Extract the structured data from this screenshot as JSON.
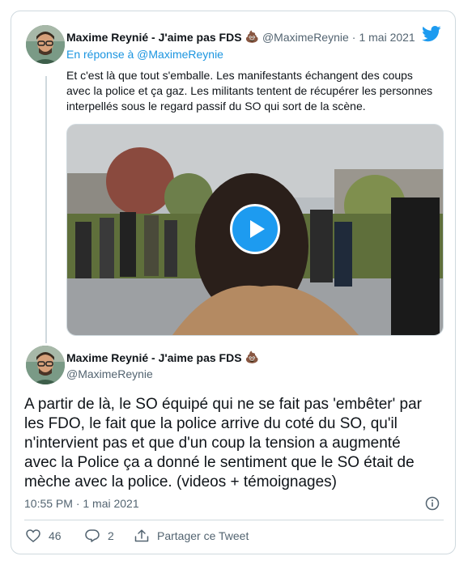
{
  "reply": {
    "author_name": "Maxime Reynié - J'aime pas FDS",
    "author_emoji": "💩",
    "author_handle": "@MaximeReynie",
    "dot": "·",
    "date": "1 mai 2021",
    "in_reply_to": "En réponse à @MaximeReynie",
    "text": "Et c'est là que tout s'emballe. Les manifestants échangent des coups avec la police et ça gaz. Les militants tentent de récupérer les personnes interpellés sous le regard passif du SO qui sort de la scène."
  },
  "main": {
    "author_name": "Maxime Reynié - J'aime pas FDS",
    "author_emoji": "💩",
    "author_handle": "@MaximeReynie",
    "text": "A partir de là, le SO équipé qui ne se fait pas 'embêter' par les FDO, le fait que la police arrive du coté du SO, qu'il n'intervient pas et que d'un coup la tension a augmenté avec la Police ça a donné le sentiment que le SO était de mèche avec la police. (videos + témoignages)",
    "timestamp": "10:55 PM · 1 mai 2021"
  },
  "actions": {
    "likes": "46",
    "replies": "2",
    "share_label": "Partager ce Tweet"
  },
  "icons": {
    "brand": "twitter-bird-icon",
    "info": "info-icon",
    "like": "heart-icon",
    "reply": "reply-icon",
    "share": "share-icon",
    "play": "play-icon"
  },
  "colors": {
    "accent": "#1d9bf0",
    "muted": "#536471",
    "border": "#cfd9de"
  }
}
